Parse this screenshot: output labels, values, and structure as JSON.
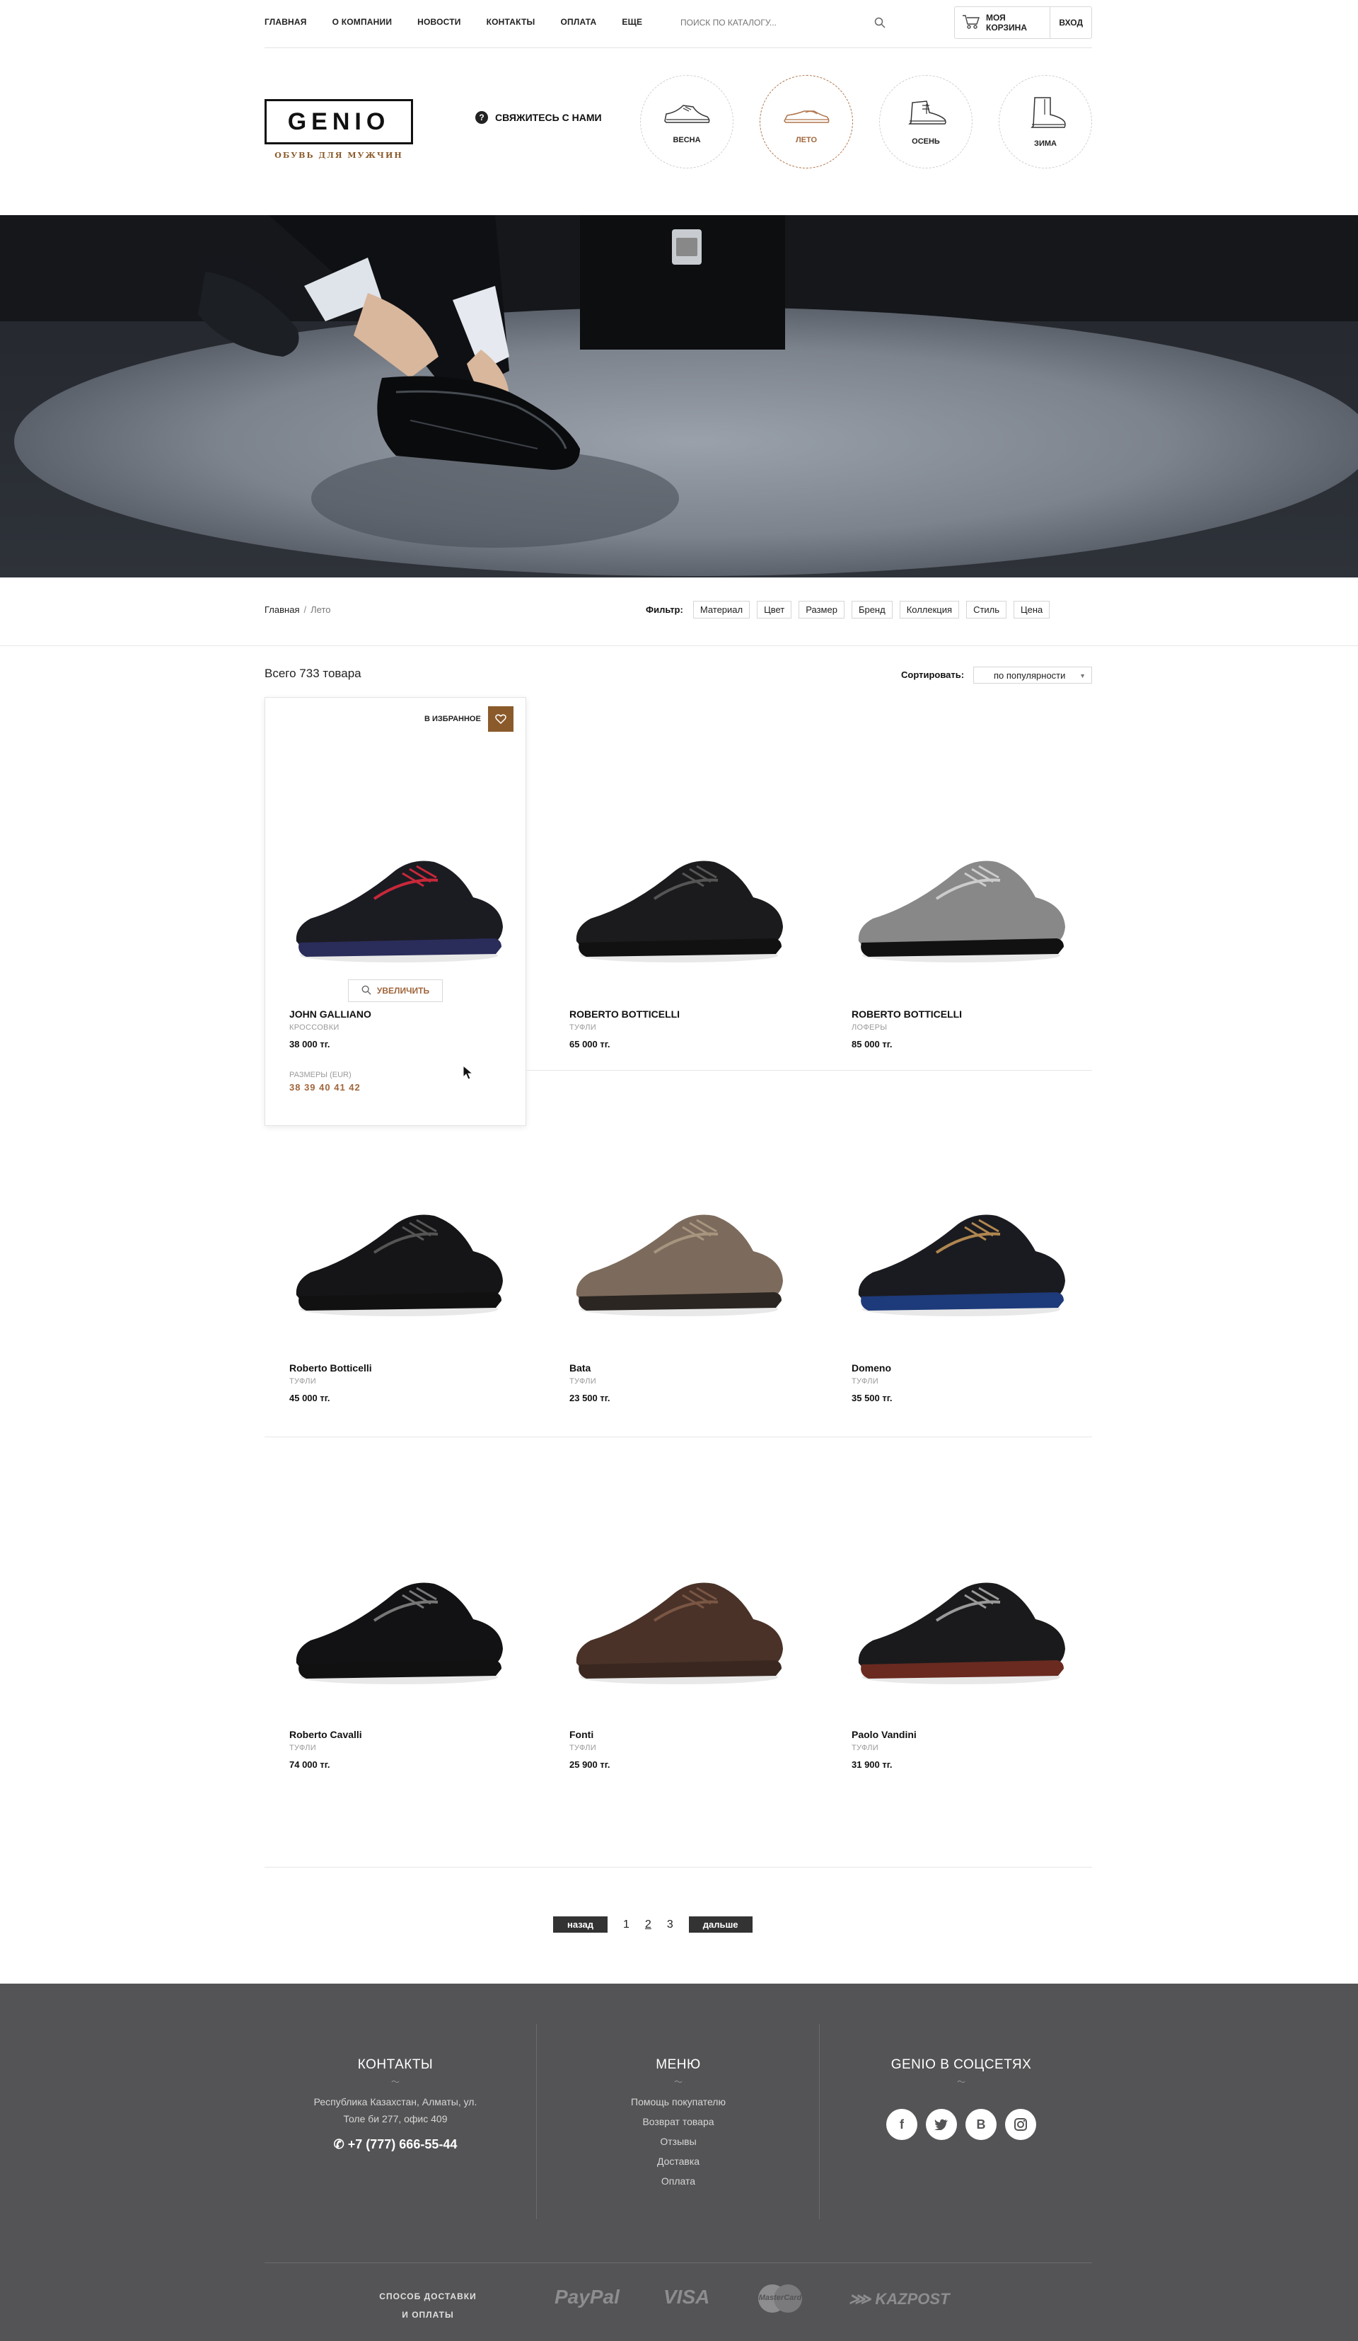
{
  "nav": {
    "links": [
      "ГЛАВНАЯ",
      "О КОМПАНИИ",
      "НОВОСТИ",
      "КОНТАКТЫ",
      "ОПЛАТА",
      "ЕЩЕ"
    ],
    "search_placeholder": "ПОИСК ПО КАТАЛОГУ...",
    "cart_label": "МОЯ КОРЗИНА",
    "login_label": "ВХОД"
  },
  "header": {
    "logo": "GENIO",
    "tagline": "ОБУВЬ ДЛЯ МУЖЧИН",
    "contact": "СВЯЖИТЕСЬ С НАМИ",
    "seasons": [
      "ВЕСНА",
      "ЛЕТО",
      "ОСЕНЬ",
      "ЗИМА"
    ],
    "active_season": "ЛЕТО"
  },
  "breadcrumb": {
    "home": "Главная",
    "current": "Лето"
  },
  "filter": {
    "label": "Фильтр:",
    "options": [
      "Материал",
      "Цвет",
      "Размер",
      "Бренд",
      "Коллекция",
      "Стиль",
      "Цена"
    ]
  },
  "listing": {
    "total": "Всего 733 товара",
    "sort_label": "Сортировать:",
    "sort_value": "по популярности",
    "favorite_label": "В ИЗБРАННОЕ",
    "zoom_label": "УВЕЛИЧИТЬ",
    "sizes_label": "РАЗМЕРЫ (EUR)",
    "sizes": "38 39 40 41 42"
  },
  "products": [
    {
      "brand": "JOHN GALLIANO",
      "type": "КРОССОВКИ",
      "price": "38 000 тг.",
      "shoe": "sneaker"
    },
    {
      "brand": "ROBERTO BOTTICELLI",
      "type": "ТУФЛИ",
      "price": "65 000 тг.",
      "shoe": "studded"
    },
    {
      "brand": "ROBERTO BOTTICELLI",
      "type": "ЛОФЕРЫ",
      "price": "85 000 тг.",
      "shoe": "loafer-snake"
    },
    {
      "brand": "Roberto Botticelli",
      "type": "ТУФЛИ",
      "price": "45 000 тг.",
      "shoe": "loafer"
    },
    {
      "brand": "Bata",
      "type": "ТУФЛИ",
      "price": "23 500 тг.",
      "shoe": "brogue"
    },
    {
      "brand": "Domeno",
      "type": "ТУФЛИ",
      "price": "35 500 тг.",
      "shoe": "derby"
    },
    {
      "brand": "Roberto Cavalli",
      "type": "ТУФЛИ",
      "price": "74 000 тг.",
      "shoe": "monk"
    },
    {
      "brand": "Fonti",
      "type": "ТУФЛИ",
      "price": "25 900 тг.",
      "shoe": "brown"
    },
    {
      "brand": "Paolo Vandini",
      "type": "ТУФЛИ",
      "price": "31 900 тг.",
      "shoe": "doublemonk"
    }
  ],
  "pagination": {
    "prev": "назад",
    "pages": [
      "1",
      "2",
      "3"
    ],
    "current": "2",
    "next": "дальше"
  },
  "footer": {
    "contacts_title": "КОНТАКТЫ",
    "address_line1": "Республика Казахстан, Алматы, ул.",
    "address_line2": "Толе би 277, офис 409",
    "phone": "+7 (777) 666-55-44",
    "menu_title": "МЕНЮ",
    "menu": [
      "Помощь покупателю",
      "Возврат товара",
      "Отзывы",
      "Доставка",
      "Оплата"
    ],
    "social_title": "GENIO В СОЦСЕТЯХ",
    "socials": [
      "facebook-icon",
      "twitter-icon",
      "vk-icon",
      "instagram-icon"
    ],
    "payment_label_1": "СПОСОБ ДОСТАВКИ",
    "payment_label_2": "И ОПЛАТЫ",
    "payment_logos": [
      "PayPal",
      "VISA",
      "MasterCard",
      "KAZPOST"
    ]
  },
  "colors": {
    "accent": "#8b5a2b",
    "footer_bg": "#545456",
    "dark": "#333333"
  }
}
